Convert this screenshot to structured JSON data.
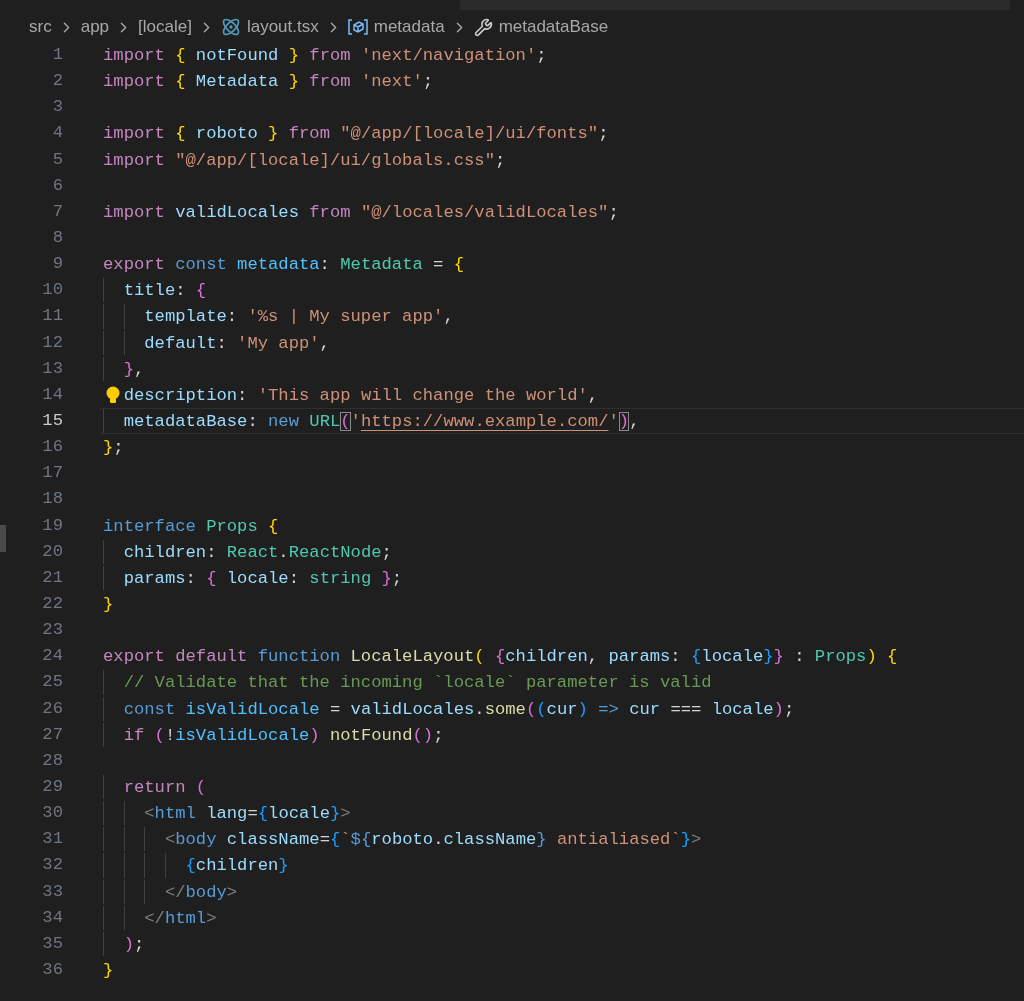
{
  "breadcrumb": [
    {
      "text": "src",
      "kind": "folder"
    },
    {
      "text": "app",
      "kind": "folder"
    },
    {
      "text": "[locale]",
      "kind": "folder"
    },
    {
      "text": "layout.tsx",
      "kind": "file"
    },
    {
      "text": "metadata",
      "kind": "symbol"
    },
    {
      "text": "metadataBase",
      "kind": "property"
    }
  ],
  "lines": [
    {
      "n": "1",
      "selected": false,
      "lightbulb": false,
      "tokens": [
        {
          "text": "import ",
          "kind": "kw"
        },
        {
          "text": "{",
          "kind": "b1"
        },
        {
          "text": " notFound ",
          "kind": "var"
        },
        {
          "text": "}",
          "kind": "b1"
        },
        {
          "text": " from ",
          "kind": "kw"
        },
        {
          "text": "'next/navigation'",
          "kind": "str"
        },
        {
          "text": ";",
          "kind": "p"
        }
      ]
    },
    {
      "n": "2",
      "selected": false,
      "lightbulb": false,
      "tokens": [
        {
          "text": "import ",
          "kind": "kw"
        },
        {
          "text": "{",
          "kind": "b1"
        },
        {
          "text": " Metadata ",
          "kind": "var"
        },
        {
          "text": "}",
          "kind": "b1"
        },
        {
          "text": " from ",
          "kind": "kw"
        },
        {
          "text": "'next'",
          "kind": "str"
        },
        {
          "text": ";",
          "kind": "p"
        }
      ]
    },
    {
      "n": "3",
      "selected": false,
      "lightbulb": false
    },
    {
      "n": "4",
      "selected": false,
      "lightbulb": false,
      "tokens": [
        {
          "text": "import ",
          "kind": "kw"
        },
        {
          "text": "{",
          "kind": "b1"
        },
        {
          "text": " roboto ",
          "kind": "var"
        },
        {
          "text": "}",
          "kind": "b1"
        },
        {
          "text": " from ",
          "kind": "kw"
        },
        {
          "text": "\"@/app/[locale]/ui/fonts\"",
          "kind": "str"
        },
        {
          "text": ";",
          "kind": "p"
        }
      ]
    },
    {
      "n": "5",
      "selected": false,
      "lightbulb": false,
      "tokens": [
        {
          "text": "import ",
          "kind": "kw"
        },
        {
          "text": "\"@/app/[locale]/ui/globals.css\"",
          "kind": "str"
        },
        {
          "text": ";",
          "kind": "p"
        }
      ]
    },
    {
      "n": "6",
      "selected": false,
      "lightbulb": false
    },
    {
      "n": "7",
      "selected": false,
      "lightbulb": false,
      "tokens": [
        {
          "text": "import",
          "kind": "kw"
        },
        {
          "text": " validLocales ",
          "kind": "var"
        },
        {
          "text": "from ",
          "kind": "kw"
        },
        {
          "text": "\"@/locales/validLocales\"",
          "kind": "str"
        },
        {
          "text": ";",
          "kind": "p"
        }
      ]
    },
    {
      "n": "8",
      "selected": false,
      "lightbulb": false
    },
    {
      "n": "9",
      "selected": false,
      "lightbulb": false,
      "tokens": [
        {
          "text": "export ",
          "kind": "kw"
        },
        {
          "text": "const ",
          "kind": "storage"
        },
        {
          "text": "metadata",
          "kind": "const"
        },
        {
          "text": ": ",
          "kind": "p"
        },
        {
          "text": "Metadata",
          "kind": "type"
        },
        {
          "text": " = ",
          "kind": "p"
        },
        {
          "text": "{",
          "kind": "b1"
        }
      ]
    },
    {
      "n": "10",
      "selected": false,
      "lightbulb": false,
      "tokens": [
        {
          "text": "  title",
          "kind": "var"
        },
        {
          "text": ": ",
          "kind": "p"
        },
        {
          "text": "{",
          "kind": "b2"
        }
      ]
    },
    {
      "n": "11",
      "selected": false,
      "lightbulb": false,
      "tokens": [
        {
          "text": "    template",
          "kind": "var"
        },
        {
          "text": ": ",
          "kind": "p"
        },
        {
          "text": "'%s | My super app'",
          "kind": "str"
        },
        {
          "text": ",",
          "kind": "p"
        }
      ]
    },
    {
      "n": "12",
      "selected": false,
      "lightbulb": false,
      "tokens": [
        {
          "text": "    default",
          "kind": "var"
        },
        {
          "text": ": ",
          "kind": "p"
        },
        {
          "text": "'My app'",
          "kind": "str"
        },
        {
          "text": ",",
          "kind": "p"
        }
      ]
    },
    {
      "n": "13",
      "selected": false,
      "lightbulb": false,
      "tokens": [
        {
          "text": "  }",
          "kind": "b2"
        },
        {
          "text": ",",
          "kind": "p"
        }
      ]
    },
    {
      "n": "14",
      "selected": false,
      "lightbulb": true,
      "tokens": [
        {
          "text": "  description",
          "kind": "var"
        },
        {
          "text": ": ",
          "kind": "p"
        },
        {
          "text": "'This app will change the world'",
          "kind": "str"
        },
        {
          "text": ",",
          "kind": "p"
        }
      ]
    },
    {
      "n": "15",
      "selected": true,
      "lightbulb": false,
      "tokens": [
        {
          "text": "  metadataBase",
          "kind": "var"
        },
        {
          "text": ": ",
          "kind": "p"
        },
        {
          "text": "new ",
          "kind": "storage"
        },
        {
          "text": "URL",
          "kind": "type"
        },
        {
          "text": "(",
          "kind": "b2match"
        },
        {
          "text": "'",
          "kind": "str"
        },
        {
          "text": "https://www.example.com/",
          "kind": "link"
        },
        {
          "text": "'",
          "kind": "str"
        },
        {
          "text": ")",
          "kind": "b2match"
        },
        {
          "text": ",",
          "kind": "p"
        }
      ]
    },
    {
      "n": "16",
      "selected": false,
      "lightbulb": false,
      "tokens": [
        {
          "text": "}",
          "kind": "b1"
        },
        {
          "text": ";",
          "kind": "p"
        }
      ]
    },
    {
      "n": "17",
      "selected": false,
      "lightbulb": false
    },
    {
      "n": "18",
      "selected": false,
      "lightbulb": false
    },
    {
      "n": "19",
      "selected": false,
      "lightbulb": false,
      "tokens": [
        {
          "text": "interface ",
          "kind": "storage"
        },
        {
          "text": "Props ",
          "kind": "type"
        },
        {
          "text": "{",
          "kind": "b1"
        }
      ]
    },
    {
      "n": "20",
      "selected": false,
      "lightbulb": false,
      "tokens": [
        {
          "text": "  children",
          "kind": "var"
        },
        {
          "text": ": ",
          "kind": "p"
        },
        {
          "text": "React",
          "kind": "type"
        },
        {
          "text": ".",
          "kind": "p"
        },
        {
          "text": "ReactNode",
          "kind": "type"
        },
        {
          "text": ";",
          "kind": "p"
        }
      ]
    },
    {
      "n": "21",
      "selected": false,
      "lightbulb": false,
      "tokens": [
        {
          "text": "  params",
          "kind": "var"
        },
        {
          "text": ": ",
          "kind": "p"
        },
        {
          "text": "{",
          "kind": "b2"
        },
        {
          "text": " locale",
          "kind": "var"
        },
        {
          "text": ": ",
          "kind": "p"
        },
        {
          "text": "string ",
          "kind": "type"
        },
        {
          "text": "}",
          "kind": "b2"
        },
        {
          "text": ";",
          "kind": "p"
        }
      ]
    },
    {
      "n": "22",
      "selected": false,
      "lightbulb": false,
      "tokens": [
        {
          "text": "}",
          "kind": "b1"
        }
      ]
    },
    {
      "n": "23",
      "selected": false,
      "lightbulb": false
    },
    {
      "n": "24",
      "selected": false,
      "lightbulb": false,
      "tokens": [
        {
          "text": "export default ",
          "kind": "kw"
        },
        {
          "text": "function ",
          "kind": "storage"
        },
        {
          "text": "LocaleLayout",
          "kind": "fn"
        },
        {
          "text": "( ",
          "kind": "b1"
        },
        {
          "text": "{",
          "kind": "b2"
        },
        {
          "text": "children",
          "kind": "var"
        },
        {
          "text": ", ",
          "kind": "p"
        },
        {
          "text": "params",
          "kind": "var"
        },
        {
          "text": ": ",
          "kind": "p"
        },
        {
          "text": "{",
          "kind": "b3"
        },
        {
          "text": "locale",
          "kind": "var"
        },
        {
          "text": "}",
          "kind": "b3"
        },
        {
          "text": "}",
          "kind": "b2"
        },
        {
          "text": " : ",
          "kind": "p"
        },
        {
          "text": "Props",
          "kind": "type"
        },
        {
          "text": ") {",
          "kind": "b1"
        }
      ]
    },
    {
      "n": "25",
      "selected": false,
      "lightbulb": false,
      "tokens": [
        {
          "text": "  // Validate that the incoming `locale` parameter is valid",
          "kind": "comment"
        }
      ]
    },
    {
      "n": "26",
      "selected": false,
      "lightbulb": false,
      "tokens": [
        {
          "text": "  const ",
          "kind": "storage"
        },
        {
          "text": "isValidLocale",
          "kind": "const"
        },
        {
          "text": " = ",
          "kind": "p"
        },
        {
          "text": "validLocales",
          "kind": "var"
        },
        {
          "text": ".",
          "kind": "p"
        },
        {
          "text": "some",
          "kind": "fn"
        },
        {
          "text": "(",
          "kind": "b2"
        },
        {
          "text": "(",
          "kind": "b3"
        },
        {
          "text": "cur",
          "kind": "var"
        },
        {
          "text": ")",
          "kind": "b3"
        },
        {
          "text": " => ",
          "kind": "storage"
        },
        {
          "text": "cur",
          "kind": "var"
        },
        {
          "text": " === ",
          "kind": "p"
        },
        {
          "text": "locale",
          "kind": "var"
        },
        {
          "text": ")",
          "kind": "b2"
        },
        {
          "text": ";",
          "kind": "p"
        }
      ]
    },
    {
      "n": "27",
      "selected": false,
      "lightbulb": false,
      "tokens": [
        {
          "text": "  if ",
          "kind": "kw"
        },
        {
          "text": "(",
          "kind": "b2"
        },
        {
          "text": "!",
          "kind": "p"
        },
        {
          "text": "isValidLocale",
          "kind": "const"
        },
        {
          "text": ") ",
          "kind": "b2"
        },
        {
          "text": "notFound",
          "kind": "fn"
        },
        {
          "text": "()",
          "kind": "b2"
        },
        {
          "text": ";",
          "kind": "p"
        }
      ]
    },
    {
      "n": "28",
      "selected": false,
      "lightbulb": false
    },
    {
      "n": "29",
      "selected": false,
      "lightbulb": false,
      "tokens": [
        {
          "text": "  return ",
          "kind": "kw"
        },
        {
          "text": "(",
          "kind": "b2"
        }
      ]
    },
    {
      "n": "30",
      "selected": false,
      "lightbulb": false,
      "tokens": [
        {
          "text": "    <",
          "kind": "tagp"
        },
        {
          "text": "html",
          "kind": "tag"
        },
        {
          "text": " lang",
          "kind": "var"
        },
        {
          "text": "=",
          "kind": "p"
        },
        {
          "text": "{",
          "kind": "b3"
        },
        {
          "text": "locale",
          "kind": "var"
        },
        {
          "text": "}",
          "kind": "b3"
        },
        {
          "text": ">",
          "kind": "tagp"
        }
      ]
    },
    {
      "n": "31",
      "selected": false,
      "lightbulb": false,
      "tokens": [
        {
          "text": "      <",
          "kind": "tagp"
        },
        {
          "text": "body",
          "kind": "tag"
        },
        {
          "text": " className",
          "kind": "var"
        },
        {
          "text": "=",
          "kind": "p"
        },
        {
          "text": "{",
          "kind": "b3"
        },
        {
          "text": "`",
          "kind": "str"
        },
        {
          "text": "${",
          "kind": "tag"
        },
        {
          "text": "roboto",
          "kind": "var"
        },
        {
          "text": ".",
          "kind": "p"
        },
        {
          "text": "className",
          "kind": "var"
        },
        {
          "text": "}",
          "kind": "tag"
        },
        {
          "text": " antialiased`",
          "kind": "str"
        },
        {
          "text": "}",
          "kind": "b3"
        },
        {
          "text": ">",
          "kind": "tagp"
        }
      ]
    },
    {
      "n": "32",
      "selected": false,
      "lightbulb": false,
      "tokens": [
        {
          "text": "        {",
          "kind": "b3"
        },
        {
          "text": "children",
          "kind": "var"
        },
        {
          "text": "}",
          "kind": "b3"
        }
      ]
    },
    {
      "n": "33",
      "selected": false,
      "lightbulb": false,
      "tokens": [
        {
          "text": "      </",
          "kind": "tagp"
        },
        {
          "text": "body",
          "kind": "tag"
        },
        {
          "text": ">",
          "kind": "tagp"
        }
      ]
    },
    {
      "n": "34",
      "selected": false,
      "lightbulb": false,
      "tokens": [
        {
          "text": "    </",
          "kind": "tagp"
        },
        {
          "text": "html",
          "kind": "tag"
        },
        {
          "text": ">",
          "kind": "tagp"
        }
      ]
    },
    {
      "n": "35",
      "selected": false,
      "lightbulb": false,
      "tokens": [
        {
          "text": "  )",
          "kind": "b2"
        },
        {
          "text": ";",
          "kind": "p"
        }
      ]
    },
    {
      "n": "36",
      "selected": false,
      "lightbulb": false,
      "tokens": [
        {
          "text": "}",
          "kind": "b1"
        }
      ]
    }
  ]
}
